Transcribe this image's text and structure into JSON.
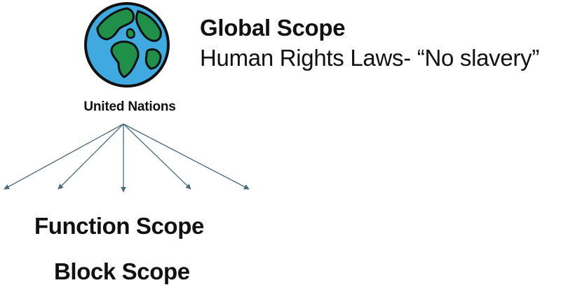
{
  "organization_label": "United Nations",
  "global": {
    "title": "Global Scope",
    "subtitle": "Human Rights Laws- “No slavery”"
  },
  "scopes": [
    "Function Scope",
    "Block Scope"
  ],
  "icons": {
    "globe": "globe-icon"
  },
  "colors": {
    "ocean": "#3fa9e0",
    "land": "#1f8f4a",
    "outline": "#111111",
    "arrow": "#4a6a7a"
  }
}
